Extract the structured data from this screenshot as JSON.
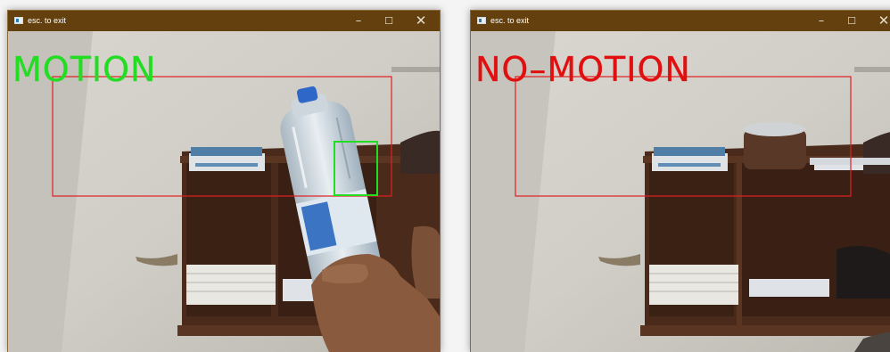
{
  "windows": [
    {
      "title": "esc. to exit",
      "controls": {
        "minimize": "–",
        "maximize": "☐",
        "close": "✕"
      },
      "status_label": "MOTION",
      "status_color": "#22dd22"
    },
    {
      "title": "esc. to exit",
      "controls": {
        "minimize": "–",
        "maximize": "☐",
        "close": "✕"
      },
      "status_label": "NO–MOTION",
      "status_color": "#e01010"
    }
  ],
  "colors": {
    "titlebar": "#63400d",
    "roi_rect": "#e02020",
    "motion_box": "#22dd22"
  }
}
